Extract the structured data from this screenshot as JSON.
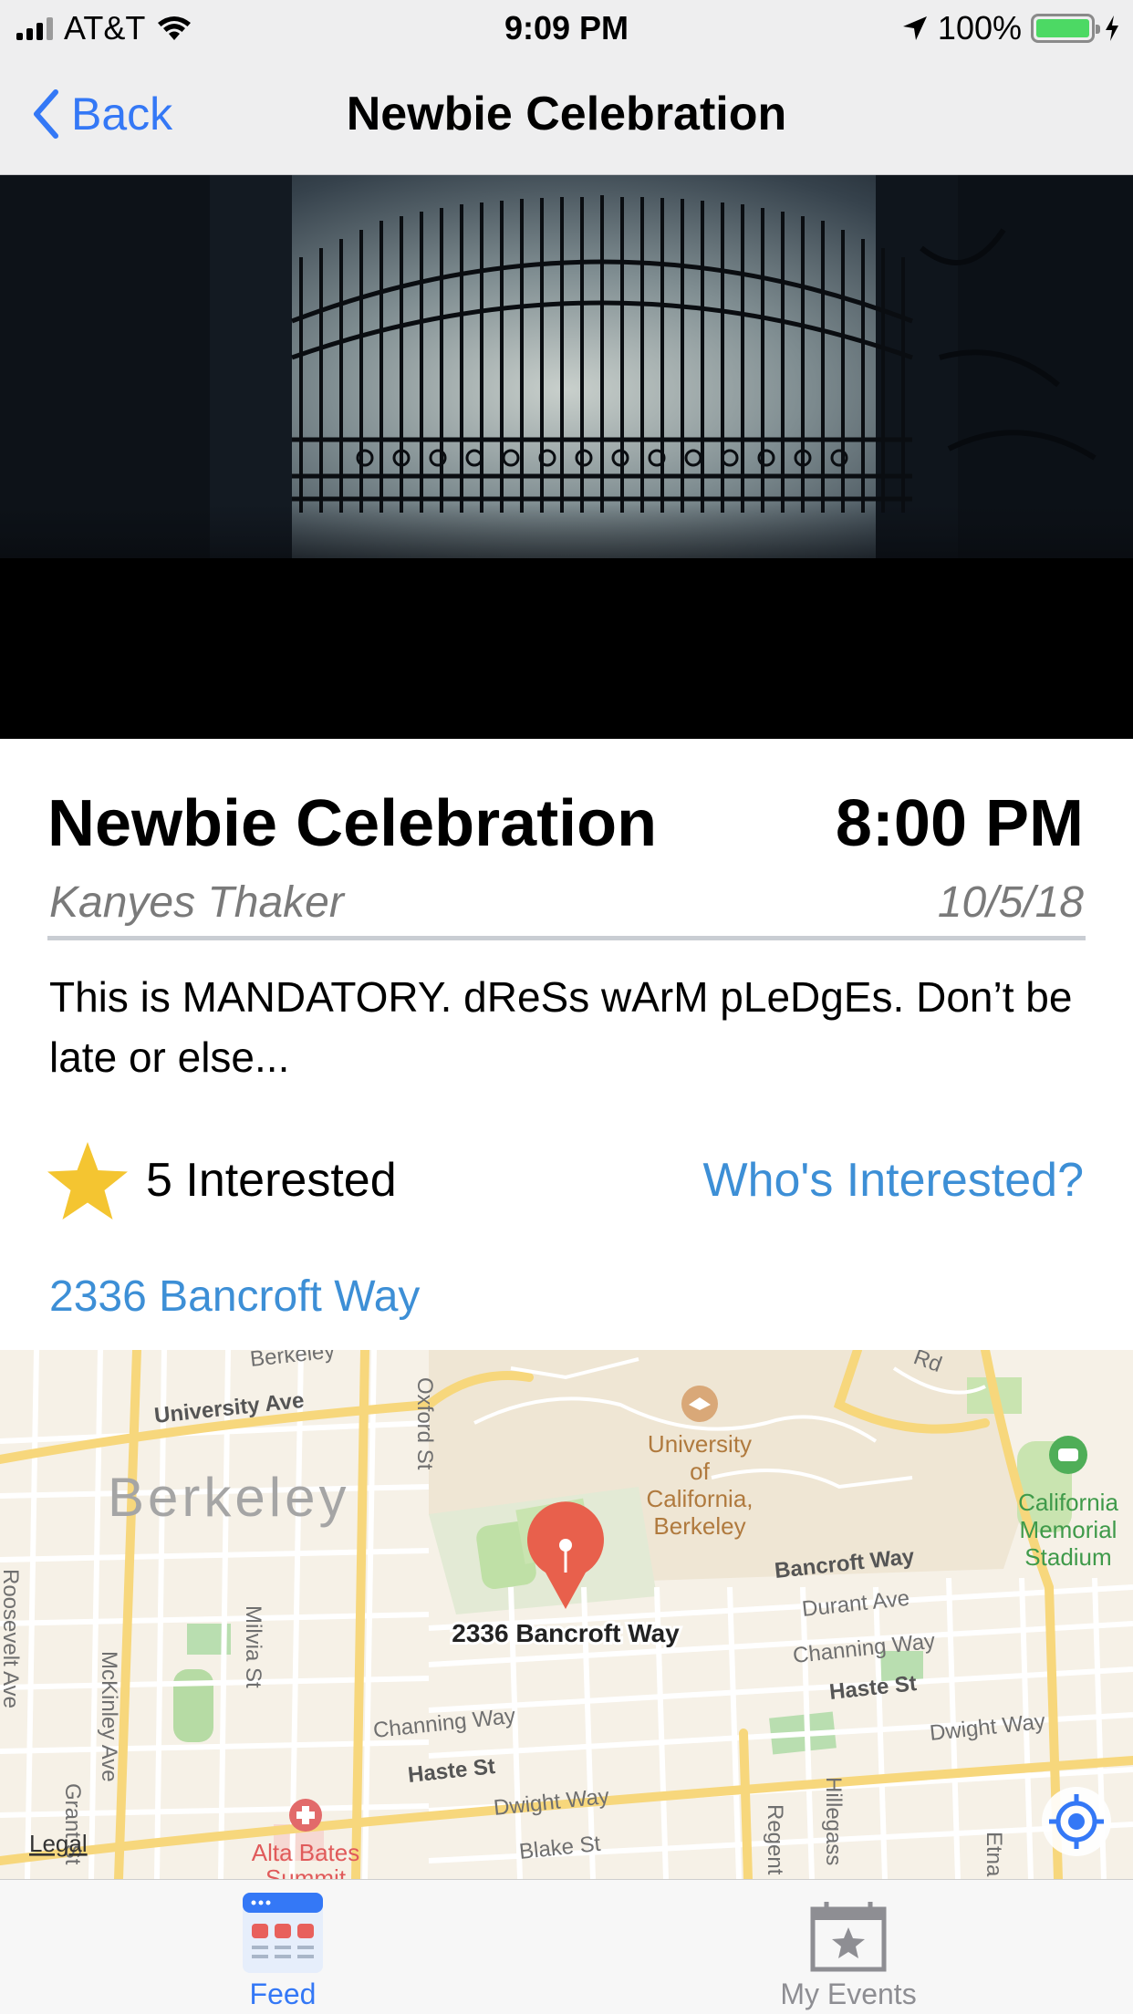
{
  "status_bar": {
    "carrier": "AT&T",
    "time": "9:09 PM",
    "battery": "100%"
  },
  "nav": {
    "back_label": "Back",
    "title": "Newbie Celebration"
  },
  "event": {
    "title": "Newbie Celebration",
    "time": "8:00 PM",
    "host": "Kanyes Thaker",
    "date": "10/5/18",
    "description": "This is MANDATORY. dReSs wArM pLeDgEs. Don’t be late or else...",
    "interested_count": "5 Interested",
    "whos_interested": "Who's Interested?",
    "address": "2336 Bancroft Way"
  },
  "map": {
    "city_label": "Berkeley",
    "pin_label": "2336 Bancroft Way",
    "campus_label_1": "University",
    "campus_label_2": "of",
    "campus_label_3": "California,",
    "campus_label_4": "Berkeley",
    "stadium_label_1": "California",
    "stadium_label_2": "Memorial",
    "stadium_label_3": "Stadium",
    "hospital_label_1": "Alta Bates",
    "hospital_label_2": "Summit",
    "legal": "Legal",
    "streets": {
      "university": "University Ave",
      "berkeley": "Berkeley",
      "oxford": "Oxford St",
      "bancroft": "Bancroft Way",
      "durant": "Durant Ave",
      "channing_r": "Channing Way",
      "channing_l": "Channing Way",
      "haste_r": "Haste St",
      "haste_l": "Haste St",
      "dwight_r": "Dwight Way",
      "dwight_l": "Dwight Way",
      "blake": "Blake St",
      "milvia": "Milvia St",
      "mckinley": "McKinley Ave",
      "roosevelt": "Roosevelt Ave",
      "grant": "Grant St",
      "regent": "Regent",
      "hillegass": "Hillegass",
      "etna": "Etna",
      "rd": "Rd"
    }
  },
  "tabs": [
    {
      "label": "Feed",
      "active": true
    },
    {
      "label": "My Events",
      "active": false
    }
  ],
  "colors": {
    "link": "#3d8fd6",
    "ios_blue": "#3478f6",
    "star": "#f4c531",
    "pin": "#e8604c",
    "battery": "#4cd964",
    "tab_active": "#3478f6",
    "tab_inactive": "#8e8e93"
  }
}
